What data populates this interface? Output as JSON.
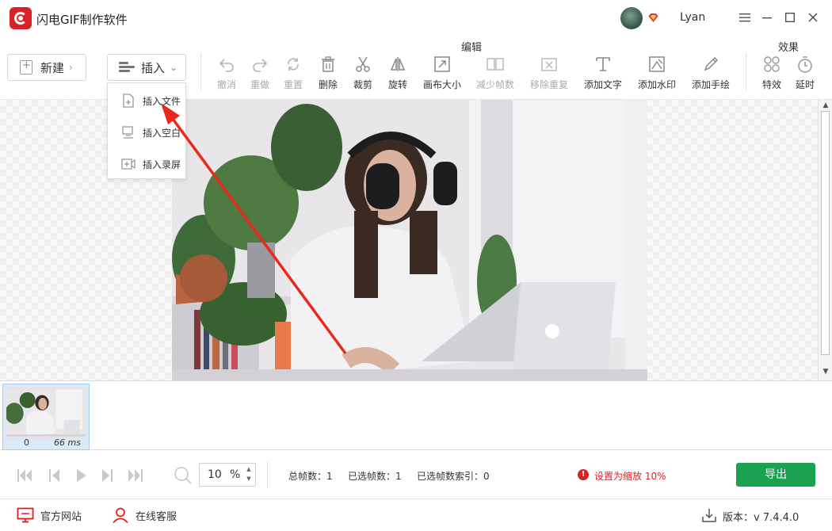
{
  "app": {
    "title": "闪电GIF制作软件",
    "username": "Lyan",
    "brand_color": "#d8222a"
  },
  "window_controls": {
    "menu_icon": "hamburger-icon",
    "minimize_icon": "minimize-icon",
    "maximize_icon": "maximize-icon",
    "close_icon": "close-icon"
  },
  "toolbar": {
    "new_label": "新建",
    "insert_label": "插入",
    "edit_group_label": "编辑",
    "effects_group_label": "效果",
    "edit_tools": [
      {
        "label": "撤消",
        "icon": "undo-icon",
        "enabled": false
      },
      {
        "label": "重做",
        "icon": "redo-icon",
        "enabled": false
      },
      {
        "label": "重置",
        "icon": "reset-icon",
        "enabled": false
      },
      {
        "label": "删除",
        "icon": "trash-icon",
        "enabled": true
      },
      {
        "label": "裁剪",
        "icon": "scissors-icon",
        "enabled": true
      },
      {
        "label": "旋转",
        "icon": "rotate-icon",
        "enabled": true
      },
      {
        "label": "画布大小",
        "icon": "canvas-size-icon",
        "enabled": true
      },
      {
        "label": "减少帧数",
        "icon": "reduce-frames-icon",
        "enabled": false
      },
      {
        "label": "移除重复",
        "icon": "remove-duplicate-icon",
        "enabled": false
      },
      {
        "label": "添加文字",
        "icon": "text-icon",
        "enabled": true
      },
      {
        "label": "添加水印",
        "icon": "watermark-icon",
        "enabled": true
      },
      {
        "label": "添加手绘",
        "icon": "pen-icon",
        "enabled": true
      }
    ],
    "effect_tools": [
      {
        "label": "特效",
        "icon": "effects-icon",
        "enabled": true
      },
      {
        "label": "延时",
        "icon": "timer-icon",
        "enabled": true
      }
    ]
  },
  "insert_menu": {
    "items": [
      {
        "label": "插入文件",
        "icon": "insert-file-icon"
      },
      {
        "label": "插入空白",
        "icon": "insert-blank-icon"
      },
      {
        "label": "插入录屏",
        "icon": "insert-recording-icon"
      }
    ]
  },
  "frames": [
    {
      "index": "0",
      "duration": "66 ms"
    }
  ],
  "playback": {
    "zoom_value": "10",
    "zoom_unit": "%",
    "total_frames_label": "总帧数：",
    "total_frames": "1",
    "selected_frames_label": "已选帧数：",
    "selected_frames": "1",
    "selected_index_label": "已选帧数索引：",
    "selected_index": "0",
    "warning_text": "设置为缩放 10%",
    "warning_color": "#e02020",
    "export_label": "导出",
    "export_color": "#1aa251"
  },
  "footer": {
    "website_label": "官方网站",
    "support_label": "在线客服",
    "version_label": "版本：",
    "version_value": "v 7.4.4.0"
  }
}
